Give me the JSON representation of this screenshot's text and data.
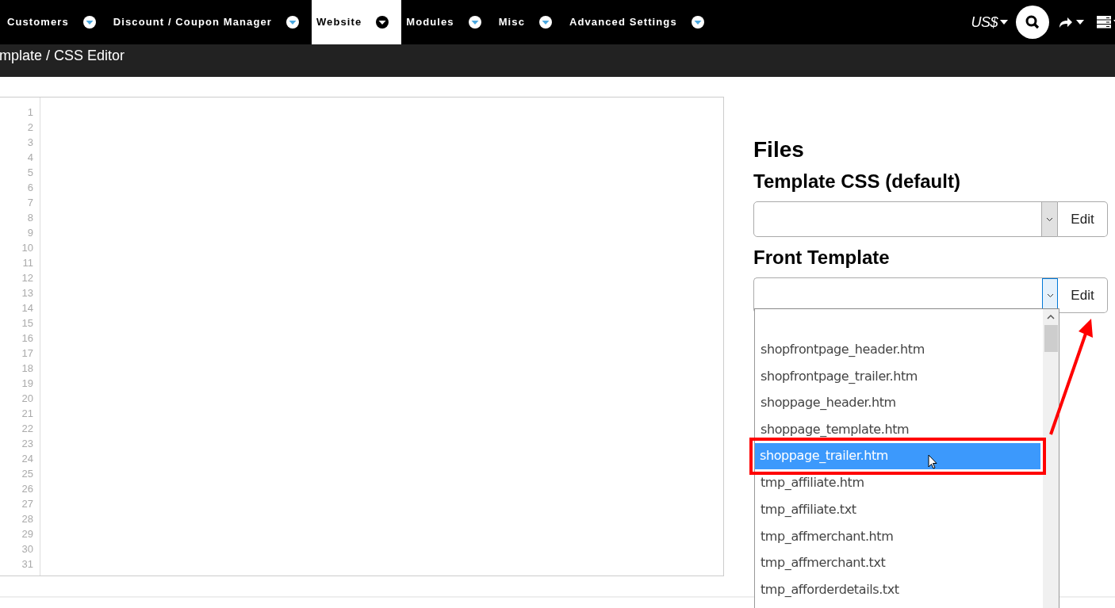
{
  "nav": {
    "items": [
      {
        "label": "Customers",
        "selected": false
      },
      {
        "label": "Discount / Coupon Manager",
        "selected": false
      },
      {
        "label": "Website",
        "selected": true
      },
      {
        "label": "Modules",
        "selected": false
      },
      {
        "label": "Misc",
        "selected": false
      },
      {
        "label": "Advanced Settings",
        "selected": false
      }
    ],
    "currency": "US$"
  },
  "breadcrumb": "mplate / CSS Editor",
  "editor": {
    "line_numbers": [
      "1",
      "2",
      "3",
      "4",
      "5",
      "6",
      "7",
      "8",
      "9",
      "10",
      "11",
      "12",
      "13",
      "14",
      "15",
      "16",
      "17",
      "18",
      "19",
      "20",
      "21",
      "22",
      "23",
      "24",
      "25",
      "26",
      "27",
      "28",
      "29",
      "30",
      "31"
    ]
  },
  "files": {
    "title": "Files",
    "sections": [
      {
        "title": "Template CSS (default)",
        "button": "Edit",
        "expanded": false
      },
      {
        "title": "Front Template",
        "button": "Edit",
        "expanded": true,
        "options": [
          {
            "label": "shopfrontpage_header.htm",
            "selected": false
          },
          {
            "label": "shopfrontpage_trailer.htm",
            "selected": false
          },
          {
            "label": "shoppage_header.htm",
            "selected": false
          },
          {
            "label": "shoppage_template.htm",
            "selected": false
          },
          {
            "label": "shoppage_trailer.htm",
            "selected": true
          },
          {
            "label": "tmp_affiliate.htm",
            "selected": false
          },
          {
            "label": "tmp_affiliate.txt",
            "selected": false
          },
          {
            "label": "tmp_affmerchant.htm",
            "selected": false
          },
          {
            "label": "tmp_affmerchant.txt",
            "selected": false
          },
          {
            "label": "tmp_afforderdetails.txt",
            "selected": false
          }
        ]
      }
    ]
  }
}
